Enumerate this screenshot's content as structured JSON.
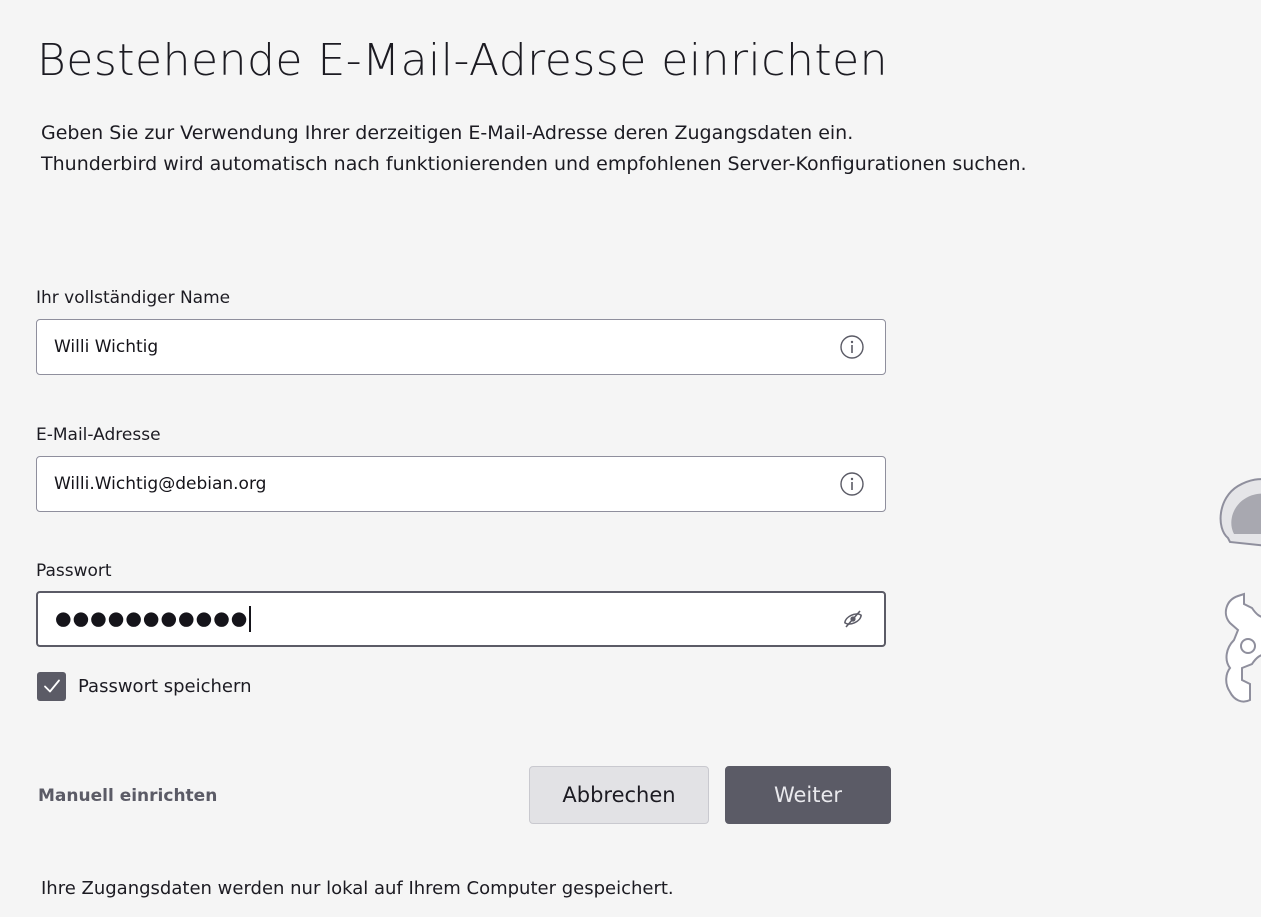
{
  "header": {
    "title": "Bestehende E-Mail-Adresse einrichten",
    "intro_line1": "Geben Sie zur Verwendung Ihrer derzeitigen E-Mail-Adresse deren Zugangsdaten ein.",
    "intro_line2": "Thunderbird wird automatisch nach funktionierenden und empfohlenen Server-Konfigurationen suchen."
  },
  "form": {
    "name": {
      "label": "Ihr vollständiger Name",
      "value": "Willi Wichtig",
      "icon": "info-icon"
    },
    "email": {
      "label": "E-Mail-Adresse",
      "value": "Willi.Wichtig@debian.org",
      "icon": "info-icon"
    },
    "password": {
      "label": "Passwort",
      "masked_value": "●●●●●●●●●●●",
      "icon": "eye-slash-icon"
    },
    "remember_password": {
      "label": "Passwort speichern",
      "checked": true
    }
  },
  "actions": {
    "manual_setup_label": "Manuell einrichten",
    "cancel_label": "Abbrechen",
    "next_label": "Weiter"
  },
  "footer": {
    "note": "Ihre Zugangsdaten werden nur lokal auf Ihrem Computer gespeichert."
  },
  "colors": {
    "background": "#f5f5f5",
    "primary_button": "#5b5b66",
    "secondary_button": "#e2e2e5",
    "input_border": "#8f8f9d",
    "text": "#1c1b22"
  }
}
